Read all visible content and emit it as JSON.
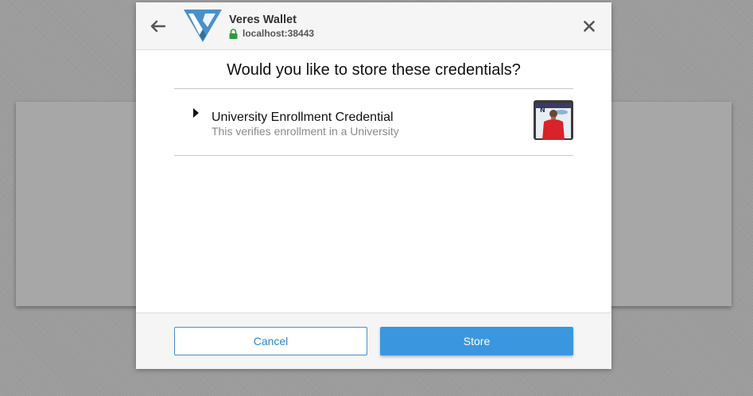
{
  "header": {
    "app_name": "Veres Wallet",
    "origin": "localhost:38443",
    "back_icon": "arrow-left-icon",
    "close_icon": "close-icon",
    "lock_icon": "lock-icon",
    "logo": "veres-v-logo"
  },
  "dialog": {
    "question": "Would you like to store these credentials?"
  },
  "credentials": [
    {
      "title": "University Enrollment Credential",
      "description": "This verifies enrollment in a University",
      "expand_icon": "caret-right-icon",
      "image": "credential-holder-photo"
    }
  ],
  "footer": {
    "cancel_label": "Cancel",
    "store_label": "Store"
  },
  "colors": {
    "accent": "#3a97df",
    "logo": "#4a90c8",
    "lock": "#2e9a3e"
  }
}
